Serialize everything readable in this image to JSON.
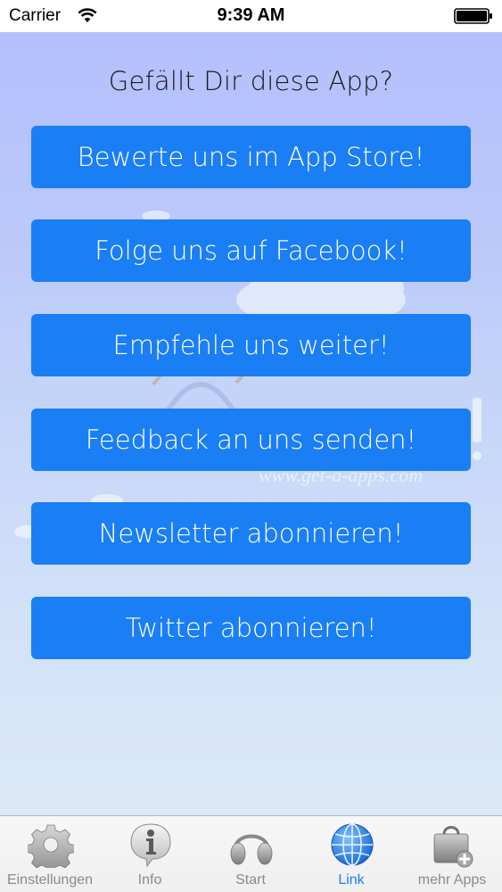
{
  "status_bar": {
    "carrier": "Carrier",
    "time": "9:39 AM",
    "wifi_icon": "wifi-icon",
    "battery_icon": "battery-icon"
  },
  "page": {
    "title": "Gefällt Dir diese App?"
  },
  "buttons": [
    {
      "label": "Bewerte uns im App Store!"
    },
    {
      "label": "Folge uns auf Facebook!"
    },
    {
      "label": "Empfehle uns weiter!"
    },
    {
      "label": "Feedback an uns senden!"
    },
    {
      "label": "Newsletter abonnieren!"
    },
    {
      "label": "Twitter abonnieren!"
    }
  ],
  "watermark": {
    "url_text": "www.get-a-apps.com",
    "icon": "headphones-icon"
  },
  "tab_bar": {
    "active_tab": "Link",
    "tabs": [
      {
        "label": "Einstellungen",
        "icon": "gear-icon"
      },
      {
        "label": "Info",
        "icon": "info-icon"
      },
      {
        "label": "Start",
        "icon": "headphones-icon"
      },
      {
        "label": "Link",
        "icon": "globe-icon"
      },
      {
        "label": "mehr Apps",
        "icon": "bag-plus-icon"
      }
    ]
  },
  "colors": {
    "button_blue": "#1a7ef5",
    "active_tab": "#1a7ef5",
    "inactive_tab": "#8a8a8a",
    "background_top": "#b4c0fd",
    "background_bottom": "#dbe9f8"
  }
}
